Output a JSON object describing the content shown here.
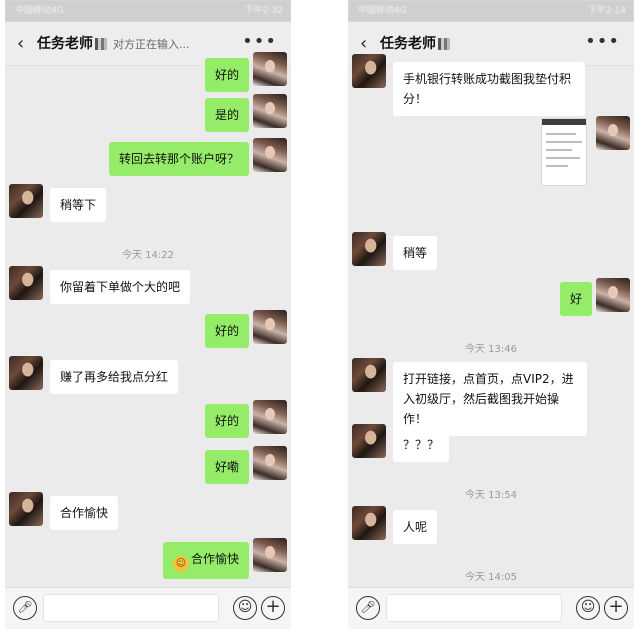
{
  "left": {
    "status": {
      "carrier": "中国移动4G",
      "time": "下午2:32"
    },
    "nav": {
      "title": "任务老师",
      "typing": "对方正在输入...",
      "more": "•••"
    },
    "messages": [
      {
        "dir": "out",
        "text": "好的"
      },
      {
        "dir": "out",
        "text": "是的"
      },
      {
        "dir": "out",
        "text": "转回去转那个账户呀？"
      },
      {
        "dir": "in",
        "text": "稍等下"
      },
      {
        "dir": "ts",
        "text": "今天 14:22"
      },
      {
        "dir": "in",
        "text": "你留着下单做个大的吧"
      },
      {
        "dir": "out",
        "text": "好的"
      },
      {
        "dir": "in",
        "text": "赚了再多给我点分红"
      },
      {
        "dir": "out",
        "text": "好的"
      },
      {
        "dir": "out",
        "text": "好嘞"
      },
      {
        "dir": "in",
        "text": "合作愉快"
      },
      {
        "dir": "out",
        "text": "合作愉快",
        "emoji": "☺"
      }
    ]
  },
  "right": {
    "status": {
      "carrier": "中国移动4G",
      "time": "下午2:14"
    },
    "nav": {
      "title": "任务老师",
      "more": "•••"
    },
    "messages": [
      {
        "dir": "in",
        "text": "手机银行转账成功截图我垫付积分！"
      },
      {
        "dir": "out",
        "type": "image"
      },
      {
        "dir": "in",
        "text": "稍等"
      },
      {
        "dir": "out",
        "text": "好"
      },
      {
        "dir": "ts",
        "text": "今天 13:46"
      },
      {
        "dir": "in",
        "text": "打开链接，点首页，点VIP2，进入初级厅，然后截图我开始操作！"
      },
      {
        "dir": "in",
        "text": "？？？"
      },
      {
        "dir": "ts",
        "text": "今天 13:54"
      },
      {
        "dir": "in",
        "text": "人呢"
      },
      {
        "dir": "ts",
        "text": "今天 14:05"
      }
    ]
  },
  "icons": {
    "back": "‹",
    "voice": "voice-icon",
    "emoji": "emoji-icon",
    "plus": "plus-icon"
  },
  "colors": {
    "bg": "#ebebeb",
    "out_bubble": "#95ec69",
    "in_bubble": "#ffffff"
  }
}
